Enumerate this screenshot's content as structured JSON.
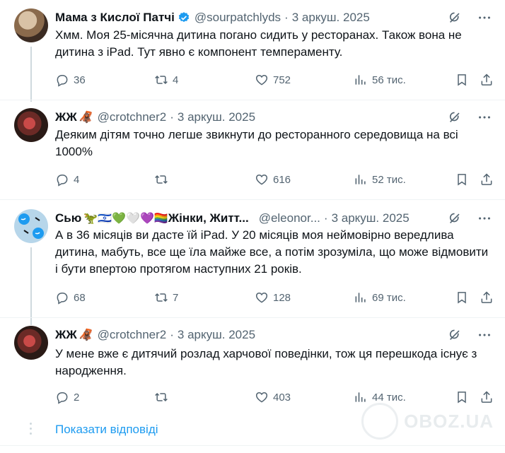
{
  "colors": {
    "text": "#0f1419",
    "muted": "#536471",
    "link": "#1d9bf0",
    "divider": "#eff3f4",
    "verified": "#1d9bf0"
  },
  "tweets": [
    {
      "name": "Мама з Кислої Патчі",
      "verified": true,
      "handle": "@sourpatchlyds",
      "date": "3 аркуш. 2025",
      "text": "Хмм. Моя 25-місячна дитина погано сидить у ресторанах. Також вона не дитина з iPad. Тут явно є компонент темпераменту.",
      "replies": "36",
      "retweets": "4",
      "likes": "752",
      "views": "56 тис."
    },
    {
      "name": "ЖЖ",
      "name_emoji": "🦧",
      "handle": "@crotchner2",
      "date": "3 аркуш. 2025",
      "text": "Деяким дітям точно легше звикнути до ресторанного середовища на всі 1000%",
      "replies": "4",
      "retweets": "",
      "likes": "616",
      "views": "52 тис."
    },
    {
      "name": "Сью",
      "name_emoji": "🦖🇮🇱💚🤍💜🏳️‍🌈",
      "name_suffix": "Жінки, Житт...",
      "handle": "@eleonor...",
      "date": "3 аркуш. 2025",
      "text": "А в 36 місяців ви дасте їй iPad. У 20 місяців моя неймовірно вередлива дитина, мабуть, все ще їла майже все, а потім зрозуміла, що може відмовити і бути впертою протягом наступних 21 років.",
      "replies": "68",
      "retweets": "7",
      "likes": "128",
      "views": "69 тис."
    },
    {
      "name": "ЖЖ",
      "name_emoji": "🦧",
      "handle": "@crotchner2",
      "date": "3 аркуш. 2025",
      "text": "У мене вже є дитячий розлад харчової поведінки, тож ця перешкода існує з народження.",
      "replies": "2",
      "retweets": "",
      "likes": "403",
      "views": "44 тис."
    }
  ],
  "show_replies": "Показати відповіді",
  "watermark": "OBOZ.UA"
}
